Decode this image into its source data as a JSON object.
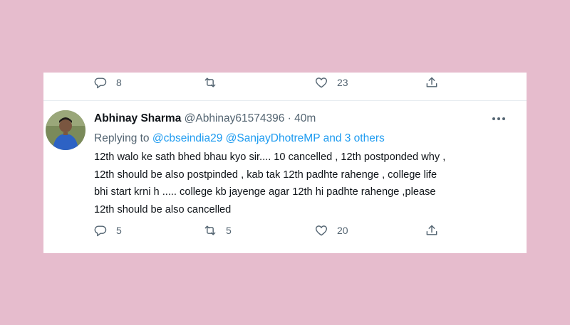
{
  "prev_tweet": {
    "reply_count": "8",
    "retweet_count": "",
    "like_count": "23"
  },
  "tweet": {
    "author_name": "Abhinay Sharma",
    "handle": "@Abhinay61574396",
    "separator": "·",
    "time": "40m",
    "replying_prefix": "Replying to",
    "mention_1": "@cbseindia29",
    "mention_2": "@SanjayDhotreMP",
    "and_others": "and 3 others",
    "text_lines": [
      "12th walo ke sath bhed bhau kyo sir.... 10 cancelled , 12th postponded why ,",
      "12th should be also postpinded , kab tak 12th padhte rahenge , college life",
      "bhi start krni h ..... college kb jayenge agar 12th hi padhte rahenge ,please",
      "12th should be also cancelled"
    ],
    "reply_count": "5",
    "retweet_count": "5",
    "like_count": "20"
  },
  "colors": {
    "background": "#e6bccd",
    "card": "#ffffff",
    "link": "#1d9bf0",
    "text": "#0f1419",
    "secondary": "#536471"
  },
  "icons": [
    "reply-icon",
    "retweet-icon",
    "like-icon",
    "share-icon",
    "more-icon"
  ]
}
